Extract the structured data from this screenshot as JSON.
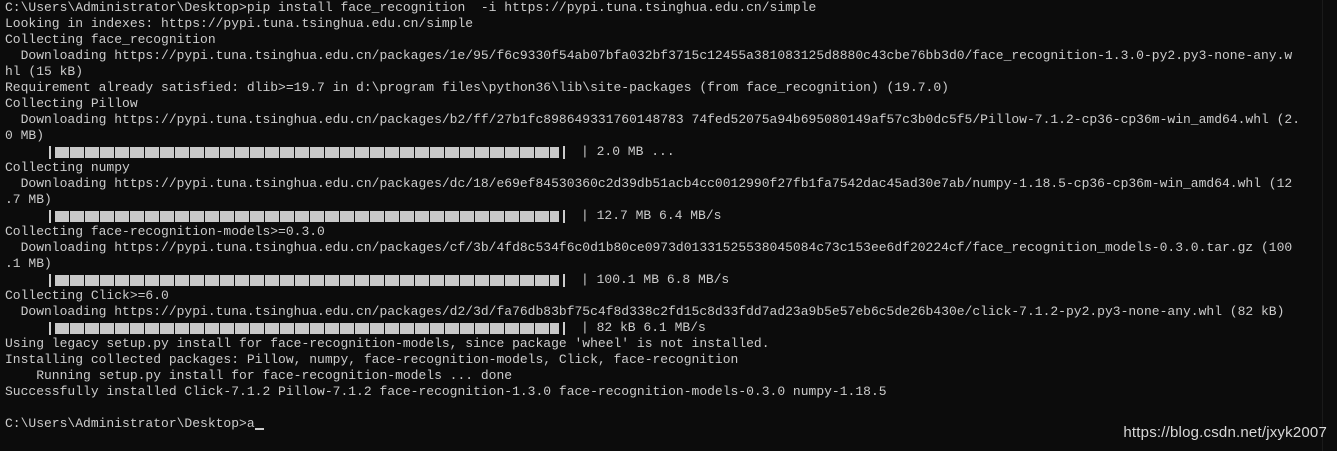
{
  "terminal": {
    "lines": [
      {
        "kind": "text",
        "text": "C:\\Users\\Administrator\\Desktop>pip install face_recognition  -i https://pypi.tuna.tsinghua.edu.cn/simple"
      },
      {
        "kind": "text",
        "text": "Looking in indexes: https://pypi.tuna.tsinghua.edu.cn/simple"
      },
      {
        "kind": "text",
        "text": "Collecting face_recognition"
      },
      {
        "kind": "text",
        "text": "  Downloading https://pypi.tuna.tsinghua.edu.cn/packages/1e/95/f6c9330f54ab07bfa032bf3715c12455a381083125d8880c43cbe76bb3d0/face_recognition-1.3.0-py2.py3-none-any.w"
      },
      {
        "kind": "text",
        "text": "hl (15 kB)"
      },
      {
        "kind": "text",
        "text": "Requirement already satisfied: dlib>=19.7 in d:\\program files\\python36\\lib\\site-packages (from face_recognition) (19.7.0)"
      },
      {
        "kind": "text",
        "text": "Collecting Pillow"
      },
      {
        "kind": "text",
        "text": "  Downloading https://pypi.tuna.tsinghua.edu.cn/packages/b2/ff/27b1fc898649331760148783 74fed52075a94b695080149af57c3b0dc5f5/Pillow-7.1.2-cp36-cp36m-win_amd64.whl (2."
      },
      {
        "kind": "text",
        "text": "0 MB)"
      },
      {
        "kind": "progress",
        "fraction": 1.0,
        "text": "| 2.0 MB ..."
      },
      {
        "kind": "text",
        "text": "Collecting numpy"
      },
      {
        "kind": "text",
        "text": "  Downloading https://pypi.tuna.tsinghua.edu.cn/packages/dc/18/e69ef84530360c2d39db51acb4cc0012990f27fb1fa7542dac45ad30e7ab/numpy-1.18.5-cp36-cp36m-win_amd64.whl (12"
      },
      {
        "kind": "text",
        "text": ".7 MB)"
      },
      {
        "kind": "progress",
        "fraction": 1.0,
        "text": "| 12.7 MB 6.4 MB/s"
      },
      {
        "kind": "text",
        "text": "Collecting face-recognition-models>=0.3.0"
      },
      {
        "kind": "text",
        "text": "  Downloading https://pypi.tuna.tsinghua.edu.cn/packages/cf/3b/4fd8c534f6c0d1b80ce0973d01331525538045084c73c153ee6df20224cf/face_recognition_models-0.3.0.tar.gz (100"
      },
      {
        "kind": "text",
        "text": ".1 MB)"
      },
      {
        "kind": "progress",
        "fraction": 1.0,
        "text": "| 100.1 MB 6.8 MB/s"
      },
      {
        "kind": "text",
        "text": "Collecting Click>=6.0"
      },
      {
        "kind": "text",
        "text": "  Downloading https://pypi.tuna.tsinghua.edu.cn/packages/d2/3d/fa76db83bf75c4f8d338c2fd15c8d33fdd7ad23a9b5e57eb6c5de26b430e/click-7.1.2-py2.py3-none-any.whl (82 kB)"
      },
      {
        "kind": "progress",
        "fraction": 1.0,
        "text": "| 82 kB 6.1 MB/s"
      },
      {
        "kind": "text",
        "text": "Using legacy setup.py install for face-recognition-models, since package 'wheel' is not installed."
      },
      {
        "kind": "text",
        "text": "Installing collected packages: Pillow, numpy, face-recognition-models, Click, face-recognition"
      },
      {
        "kind": "text",
        "text": "    Running setup.py install for face-recognition-models ... done"
      },
      {
        "kind": "text",
        "text": "Successfully installed Click-7.1.2 Pillow-7.1.2 face-recognition-1.3.0 face-recognition-models-0.3.0 numpy-1.18.5"
      },
      {
        "kind": "text",
        "text": ""
      },
      {
        "kind": "prompt",
        "text": "C:\\Users\\Administrator\\Desktop>a"
      }
    ]
  },
  "watermark": "https://blog.csdn.net/jxyk2007",
  "colors": {
    "background": "#0c0c0c",
    "foreground": "#cccccc"
  }
}
